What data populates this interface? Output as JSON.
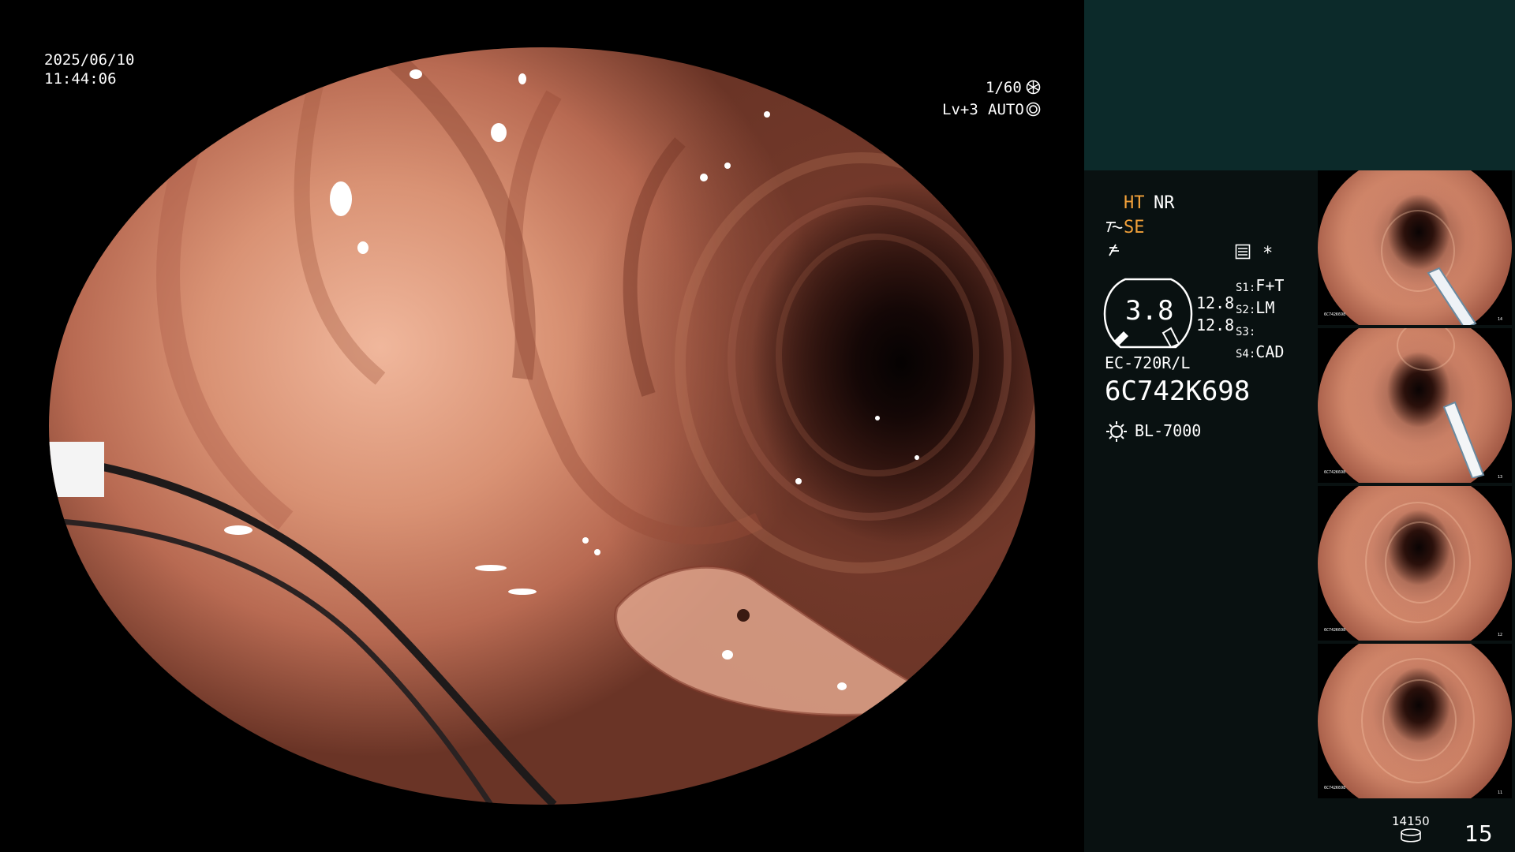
{
  "osd": {
    "date": "2025/06/10",
    "time": "11:44:06",
    "shutter": "1/60",
    "shutter_icon": "shutter-icon",
    "level": "Lv+3",
    "mode": "AUTO",
    "mode_icon": "iris-icon"
  },
  "panel": {
    "ht": "HT",
    "nr": "NR",
    "se": "SE",
    "se_icon": "structure-enhance-icon",
    "color_icon": "color-mode-icon",
    "menu_icon": "menu-icon",
    "star": "*",
    "gauge_value": "3.8",
    "gauge_side_1": "12.8",
    "gauge_side_2": "12.8",
    "switches": [
      {
        "key": "S1:",
        "value": "F+T"
      },
      {
        "key": "S2:",
        "value": "LM"
      },
      {
        "key": "S3:",
        "value": ""
      },
      {
        "key": "S4:",
        "value": "CAD"
      }
    ],
    "scope_model": "EC-720R/L",
    "serial": "6C742K698",
    "light_source": "BL-7000",
    "light_icon": "light-source-icon",
    "storage_count": "14150",
    "storage_icon": "storage-disk-icon",
    "image_count": "15"
  },
  "thumbnails": [
    {
      "serial": "6C742K698",
      "index": "14"
    },
    {
      "serial": "6C742K698",
      "index": "13"
    },
    {
      "serial": "6C742K698",
      "index": "12"
    },
    {
      "serial": "6C742K698",
      "index": "11"
    }
  ]
}
